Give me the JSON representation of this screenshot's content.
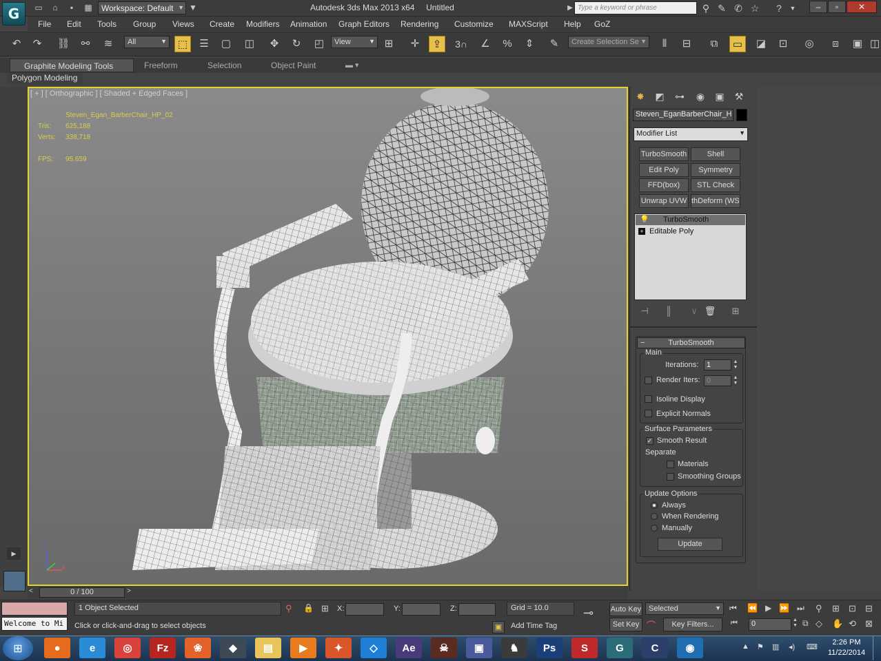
{
  "app": {
    "logo_glyph": "G",
    "title": "Autodesk 3ds Max  2013 x64",
    "document": "Untitled",
    "workspace": "Workspace: Default",
    "search_placeholder": "Type a keyword or phrase"
  },
  "menu": [
    "File",
    "Edit",
    "Tools",
    "Group",
    "Views",
    "Create",
    "Modifiers",
    "Animation",
    "Graph Editors",
    "Rendering",
    "Customize",
    "MAXScript",
    "Help",
    "GoZ"
  ],
  "toolbar": {
    "filter": "All",
    "ref_coord": "View",
    "snaps_label": "3",
    "named_selection": "Create Selection Se"
  },
  "ribbon": {
    "tabs": [
      "Graphite Modeling Tools",
      "Freeform",
      "Selection",
      "Object Paint"
    ],
    "active_tab": "Graphite Modeling Tools",
    "panel": "Polygon Modeling"
  },
  "viewport": {
    "label": "[ + ] [ Orthographic ] [ Shaded + Edged Faces ]",
    "object": "Steven_Egan_BarberChair_HP_02",
    "stats": [
      {
        "label": "Tris:",
        "value": "625,188"
      },
      {
        "label": "Verts:",
        "value": "338,718"
      },
      {
        "label": "FPS:",
        "value": "95.659"
      }
    ],
    "axis": {
      "z": "z",
      "x": "x"
    }
  },
  "command_panel": {
    "object_name": "Steven_EganBarberChair_H",
    "object_color": "#000000",
    "modifier_list": "Modifier List",
    "modifier_buttons": [
      "TurboSmooth",
      "Shell",
      "Edit Poly",
      "Symmetry",
      "FFD(box)",
      "STL Check",
      "Unwrap UVW",
      "thDeform (WSI"
    ],
    "stack": [
      "TurboSmooth",
      "Editable Poly"
    ],
    "rollout_title": "TurboSmooth",
    "main": {
      "title": "Main",
      "iterations_label": "Iterations:",
      "iterations_value": "1",
      "render_iters_label": "Render Iters:",
      "render_iters_value": "0",
      "render_iters_checked": false,
      "isoline_label": "Isoline Display",
      "isoline_checked": false,
      "explicit_label": "Explicit Normals",
      "explicit_checked": false
    },
    "surface": {
      "title": "Surface Parameters",
      "smooth_label": "Smooth Result",
      "smooth_checked": true,
      "separate_label": "Separate",
      "materials_label": "Materials",
      "materials_checked": false,
      "smoothing_label": "Smoothing Groups",
      "smoothing_checked": false
    },
    "update": {
      "title": "Update Options",
      "options": [
        "Always",
        "When Rendering",
        "Manually"
      ],
      "selected": "Always",
      "button": "Update"
    }
  },
  "timeline": {
    "position": "0 / 100"
  },
  "status": {
    "maxscript_text": "Welcome to Mi",
    "selection": "1 Object Selected",
    "prompt": "Click or click-and-drag to select objects",
    "x_label": "X:",
    "y_label": "Y:",
    "z_label": "Z:",
    "grid": "Grid = 10.0",
    "add_time_tag": "Add Time Tag",
    "auto_key": "Auto Key",
    "set_key": "Set Key",
    "key_mode": "Selected",
    "key_filters": "Key Filters...",
    "frame": "0"
  },
  "taskbar": {
    "apps": [
      {
        "name": "firefox",
        "glyph": "●",
        "color": "#e66b1d"
      },
      {
        "name": "internet-explorer",
        "glyph": "e",
        "color": "#2a8bd6"
      },
      {
        "name": "chrome",
        "glyph": "◎",
        "color": "#d9433b"
      },
      {
        "name": "filezilla",
        "glyph": "Fz",
        "color": "#b5261e"
      },
      {
        "name": "mirror",
        "glyph": "❀",
        "color": "#e2622a"
      },
      {
        "name": "unity",
        "glyph": "◆",
        "color": "#3d4a56"
      },
      {
        "name": "explorer",
        "glyph": "▤",
        "color": "#e8c45a"
      },
      {
        "name": "media-player",
        "glyph": "▶",
        "color": "#e87b1e"
      },
      {
        "name": "paint",
        "glyph": "✦",
        "color": "#d9562b"
      },
      {
        "name": "dropbox",
        "glyph": "◇",
        "color": "#1f7fd6"
      },
      {
        "name": "after-effects",
        "glyph": "Ae",
        "color": "#4b3a7a"
      },
      {
        "name": "game-app",
        "glyph": "☠",
        "color": "#5a2b1e"
      },
      {
        "name": "blender",
        "glyph": "▣",
        "color": "#4a5a9a"
      },
      {
        "name": "poser",
        "glyph": "♞",
        "color": "#3b3b3b"
      },
      {
        "name": "photoshop",
        "glyph": "Ps",
        "color": "#1b3f79"
      },
      {
        "name": "sketchbook",
        "glyph": "S",
        "color": "#c0282a"
      },
      {
        "name": "3ds-max",
        "glyph": "G",
        "color": "#2c6b78"
      },
      {
        "name": "cinema",
        "glyph": "C",
        "color": "#2c3e6a"
      },
      {
        "name": "browser-alt",
        "glyph": "◉",
        "color": "#1f6fb0"
      }
    ],
    "time": "2:26 PM",
    "date": "11/22/2014"
  }
}
